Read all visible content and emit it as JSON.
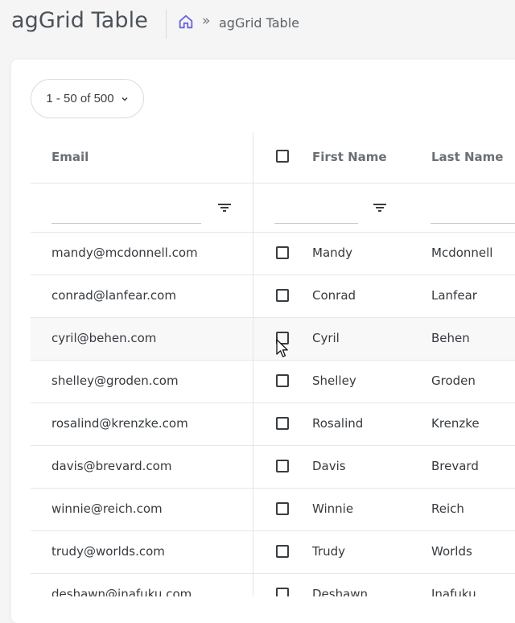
{
  "header": {
    "title": "agGrid Table",
    "breadcrumb_separator": "»",
    "breadcrumb_current": "agGrid Table",
    "home_icon": "home-icon"
  },
  "pager": {
    "label": "1 - 50 of 500"
  },
  "table": {
    "columns": [
      "Email",
      "First Name",
      "Last Name"
    ],
    "rows": [
      {
        "email": "mandy@mcdonnell.com",
        "first": "Mandy",
        "last": "Mcdonnell"
      },
      {
        "email": "conrad@lanfear.com",
        "first": "Conrad",
        "last": "Lanfear"
      },
      {
        "email": "cyril@behen.com",
        "first": "Cyril",
        "last": "Behen"
      },
      {
        "email": "shelley@groden.com",
        "first": "Shelley",
        "last": "Groden"
      },
      {
        "email": "rosalind@krenzke.com",
        "first": "Rosalind",
        "last": "Krenzke"
      },
      {
        "email": "davis@brevard.com",
        "first": "Davis",
        "last": "Brevard"
      },
      {
        "email": "winnie@reich.com",
        "first": "Winnie",
        "last": "Reich"
      },
      {
        "email": "trudy@worlds.com",
        "first": "Trudy",
        "last": "Worlds"
      },
      {
        "email": "deshawn@inafuku.com",
        "first": "Deshawn",
        "last": "Inafuku"
      }
    ]
  },
  "colors": {
    "accent": "#6c63d9",
    "border": "#e4e5e7"
  }
}
